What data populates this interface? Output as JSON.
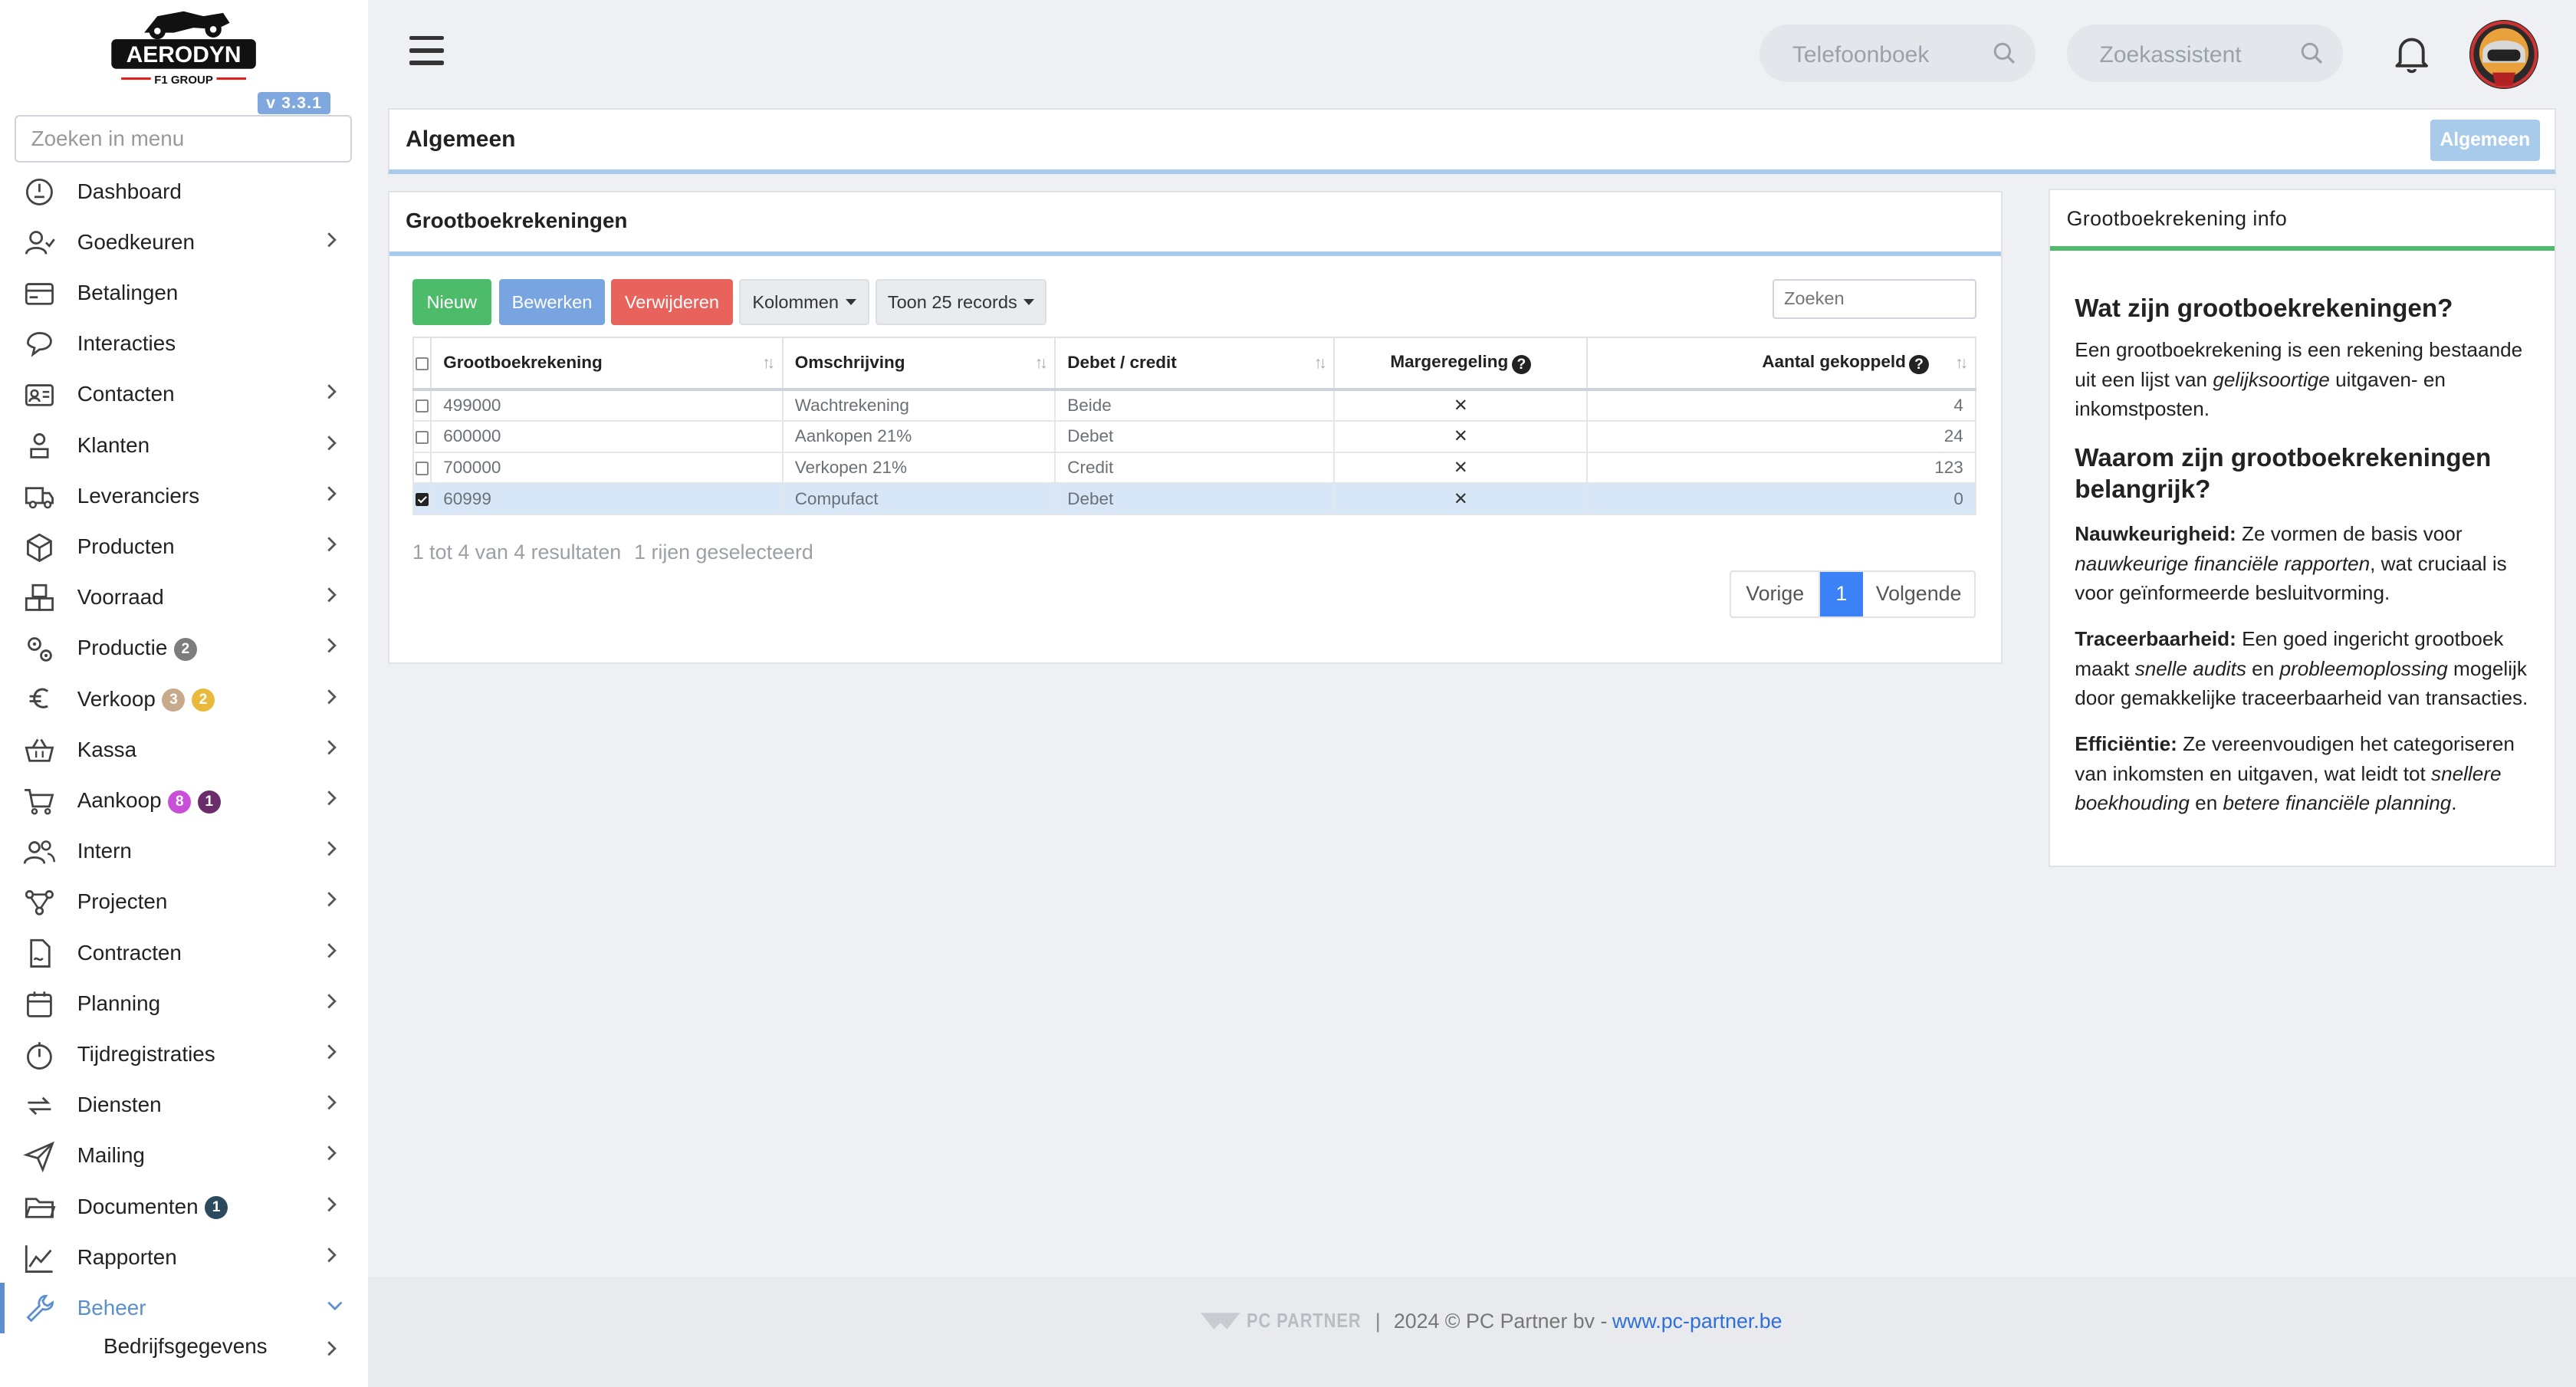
{
  "app": {
    "logo_text": "AERODYN",
    "logo_sub": "F1 GROUP",
    "version": "v 3.3.1",
    "menu_search_placeholder": "Zoeken in menu"
  },
  "sidebar": {
    "items": [
      {
        "label": "Dashboard",
        "icon": "dashboard-icon"
      },
      {
        "label": "Goedkeuren",
        "icon": "user-check-icon"
      },
      {
        "label": "Betalingen",
        "icon": "credit-card-icon"
      },
      {
        "label": "Interacties",
        "icon": "chat-icon"
      },
      {
        "label": "Contacten",
        "icon": "contact-card-icon"
      },
      {
        "label": "Klanten",
        "icon": "customer-icon"
      },
      {
        "label": "Leveranciers",
        "icon": "truck-icon"
      },
      {
        "label": "Producten",
        "icon": "box-icon"
      },
      {
        "label": "Voorraad",
        "icon": "boxes-icon"
      },
      {
        "label": "Productie",
        "icon": "gears-icon",
        "badges": [
          "2"
        ]
      },
      {
        "label": "Verkoop",
        "icon": "euro-icon",
        "badges": [
          "3",
          "2"
        ]
      },
      {
        "label": "Kassa",
        "icon": "basket-icon"
      },
      {
        "label": "Aankoop",
        "icon": "cart-icon",
        "badges": [
          "8",
          "1"
        ]
      },
      {
        "label": "Intern",
        "icon": "users-icon"
      },
      {
        "label": "Projecten",
        "icon": "project-icon"
      },
      {
        "label": "Contracten",
        "icon": "contract-icon"
      },
      {
        "label": "Planning",
        "icon": "calendar-icon"
      },
      {
        "label": "Tijdregistraties",
        "icon": "timer-icon"
      },
      {
        "label": "Diensten",
        "icon": "repeat-icon"
      },
      {
        "label": "Mailing",
        "icon": "send-icon"
      },
      {
        "label": "Documenten",
        "icon": "folder-icon",
        "badges": [
          "1"
        ]
      },
      {
        "label": "Rapporten",
        "icon": "line-chart-icon"
      },
      {
        "label": "Beheer",
        "icon": "wrench-icon"
      }
    ],
    "sub_item": "Bedrijfsgegevens",
    "badge_colors": {
      "gray": "#7d7d7d",
      "tan": "#c7a98c",
      "yellow": "#e8b93b",
      "pink": "#c94fd8",
      "purple": "#6a2c6a",
      "navy": "#2c4a5e"
    }
  },
  "header": {
    "phonebook_placeholder": "Telefoonboek",
    "assistant_placeholder": "Zoekassistent"
  },
  "page": {
    "title": "Algemeen",
    "title_button": "Algemeen"
  },
  "table_card": {
    "title": "Grootboekrekeningen",
    "buttons": {
      "new": "Nieuw",
      "edit": "Bewerken",
      "delete": "Verwijderen",
      "columns": "Kolommen",
      "show": "Toon 25 records"
    },
    "search_placeholder": "Zoeken",
    "columns": [
      "Grootboekrekening",
      "Omschrijving",
      "Debet / credit",
      "Margeregeling",
      "Aantal gekoppeld"
    ],
    "rows": [
      {
        "account": "499000",
        "description": "Wachtrekening",
        "dc": "Beide",
        "margin": "✕",
        "count": "4",
        "selected": false
      },
      {
        "account": "600000",
        "description": "Aankopen 21%",
        "dc": "Debet",
        "margin": "✕",
        "count": "24",
        "selected": false
      },
      {
        "account": "700000",
        "description": "Verkopen 21%",
        "dc": "Credit",
        "margin": "✕",
        "count": "123",
        "selected": false
      },
      {
        "account": "60999",
        "description": "Compufact",
        "dc": "Debet",
        "margin": "✕",
        "count": "0",
        "selected": true
      }
    ],
    "result_info": "1 tot 4 van 4 resultaten",
    "selected_info": "1 rijen geselecteerd",
    "pagination": {
      "prev": "Vorige",
      "current": "1",
      "next": "Volgende"
    },
    "colors": {
      "new": "#4cbb6a",
      "edit": "#78a5e0",
      "delete": "#e8635c",
      "accent": "#a8cbeb"
    }
  },
  "info_card": {
    "title": "Grootboekrekening info",
    "h1": "Wat zijn grootboekrekeningen?",
    "p1_a": "Een grootboekrekening is een rekening bestaande uit een lijst van ",
    "p1_em": "gelijksoortige",
    "p1_b": " uitgaven- en inkomstposten.",
    "h2": "Waarom zijn grootboekrekeningen belangrijk?",
    "accuracy_label": "Nauwkeurigheid:",
    "accuracy_a": " Ze vormen de basis voor ",
    "accuracy_em": "nauwkeurige financiële rapporten",
    "accuracy_b": ", wat cruciaal is voor geïnformeerde besluitvorming.",
    "trace_label": "Traceerbaarheid:",
    "trace_a": " Een goed ingericht grootboek maakt ",
    "trace_em1": "snelle audits",
    "trace_b": " en ",
    "trace_em2": "probleemoplossing",
    "trace_c": " mogelijk door gemakkelijke traceerbaarheid van transacties.",
    "eff_label": "Efficiëntie:",
    "eff_a": " Ze vereenvoudigen het categoriseren van inkomsten en uitgaven, wat leidt tot ",
    "eff_em1": "snellere boekhouding",
    "eff_b": " en ",
    "eff_em2": "betere financiële planning",
    "eff_c": ".",
    "accent": "#4cbb6a"
  },
  "footer": {
    "brand": "PC PARTNER",
    "sep": "|",
    "copyright": "2024 © PC Partner bv - ",
    "link": "www.pc-partner.be"
  }
}
